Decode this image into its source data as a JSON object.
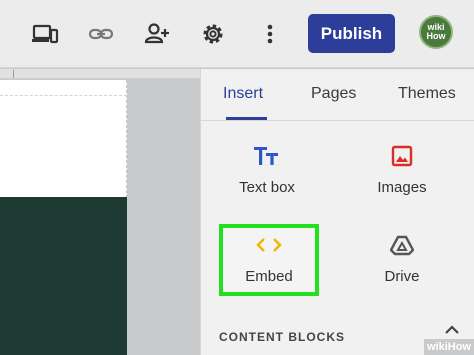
{
  "toolbar": {
    "preview_icon": "devices-icon",
    "link_icon": "link-icon",
    "share_icon": "person-add-icon",
    "settings_icon": "gear-icon",
    "more_icon": "more-vert-icon",
    "publish_label": "Publish",
    "avatar_text": "wiki How"
  },
  "panel": {
    "tabs": [
      {
        "label": "Insert",
        "active": true
      },
      {
        "label": "Pages",
        "active": false
      },
      {
        "label": "Themes",
        "active": false
      }
    ],
    "items": [
      {
        "label": "Text box",
        "icon": "text-box-icon"
      },
      {
        "label": "Images",
        "icon": "image-icon"
      },
      {
        "label": "Embed",
        "icon": "embed-code-icon",
        "highlighted": true
      },
      {
        "label": "Drive",
        "icon": "drive-icon"
      }
    ],
    "section_title": "CONTENT BLOCKS"
  },
  "colors": {
    "accent": "#2d3f96",
    "highlight": "#22e01f",
    "dark_block": "#1e3932",
    "images_icon": "#d93025",
    "embed_icon": "#f2b400"
  },
  "watermark": "wikiHow"
}
